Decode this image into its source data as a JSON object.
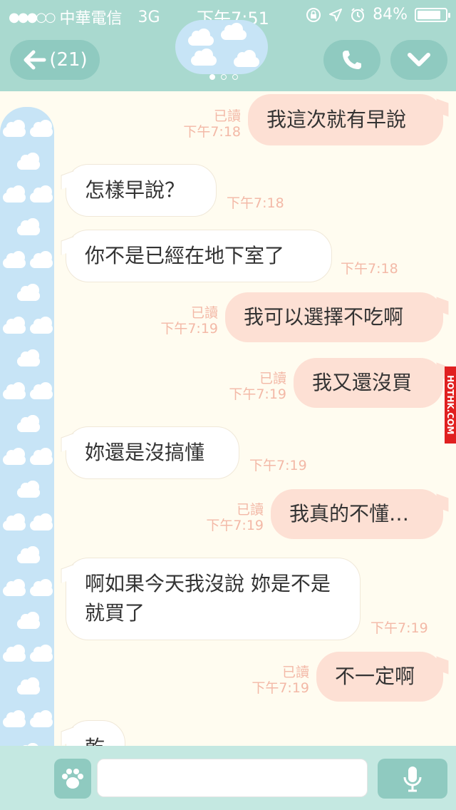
{
  "status_bar": {
    "signal": "●●●○○",
    "carrier": "中華電信",
    "network": "3G",
    "time": "下午7:51",
    "battery": "84%",
    "battery_level": 0.84
  },
  "header": {
    "back_label": "(21)",
    "page_indicator": {
      "count": 3,
      "active": 0
    }
  },
  "messages": [
    {
      "side": "out",
      "text": "我這次就有早說",
      "read": "已讀",
      "time": "下午7:18"
    },
    {
      "side": "in",
      "text": "怎樣早說？",
      "time": "下午7:18"
    },
    {
      "side": "in",
      "text": "你不是已經在地下室了",
      "time": "下午7:18"
    },
    {
      "side": "out",
      "text": "我可以選擇不吃啊",
      "read": "已讀",
      "time": "下午7:19"
    },
    {
      "side": "out",
      "text": "我又還沒買",
      "read": "已讀",
      "time": "下午7:19"
    },
    {
      "side": "in",
      "text": "妳還是沒搞懂",
      "time": "下午7:19"
    },
    {
      "side": "out",
      "text": "我真的不懂…",
      "read": "已讀",
      "time": "下午7:19"
    },
    {
      "side": "in",
      "text": "啊如果今天我沒說 妳是不是就買了",
      "time": "下午7:19"
    },
    {
      "side": "out",
      "text": "不一定啊",
      "read": "已讀",
      "time": "下午7:19"
    },
    {
      "side": "in",
      "text": "乾",
      "time": ""
    }
  ],
  "watermark": "HOTHK.COM",
  "colors": {
    "header": "#a9d9cf",
    "button": "#8fcac0",
    "outgoing_bubble": "#fde0d4",
    "incoming_bubble": "#ffffff",
    "meta_text": "#f3b9a7",
    "background": "#fffcf0",
    "cloud_sky": "#c7e4f6"
  },
  "icons": {
    "back": "arrow-left-icon",
    "call": "phone-icon",
    "more": "chevron-down-icon",
    "sticker": "paw-icon",
    "voice": "microphone-icon"
  }
}
